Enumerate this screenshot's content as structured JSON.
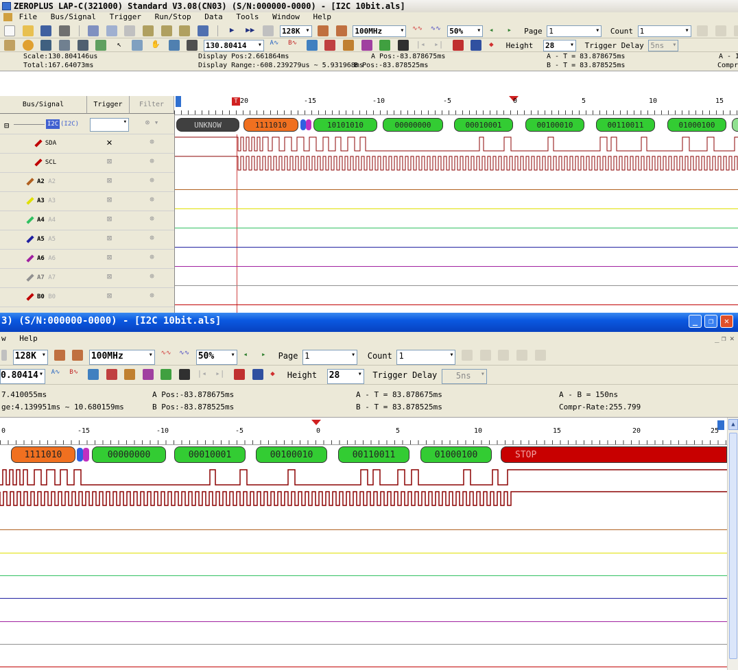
{
  "window1": {
    "title": "ZEROPLUS LAP-C(321000) Standard V3.08(CN03) (S/N:000000-0000) - [I2C 10bit.als]",
    "menu": [
      "File",
      "Bus/Signal",
      "Trigger",
      "Run/Stop",
      "Data",
      "Tools",
      "Window",
      "Help"
    ],
    "toolbar": {
      "memory": "128K",
      "clock": "100MHz",
      "ratio": "50%",
      "page_label": "Page",
      "page_value": "1",
      "count_label": "Count",
      "count_value": "1",
      "scale_combo": "130.80414",
      "height_label": "Height",
      "height_value": "28",
      "trigger_delay_label": "Trigger Delay",
      "trigger_delay_value": "5ns"
    },
    "info": {
      "scale": "Scale:130.804146us",
      "total": "Total:167.64073ms",
      "display_pos": "Display Pos:2.661864ms",
      "display_range": "Display Range:-608.239279us ~ 5.931968ms",
      "a_pos": "A Pos:-83.878675ms",
      "b_pos": "B Pos:-83.878525ms",
      "a_t": "A - T = 83.878675ms",
      "b_t": "B - T = 83.878525ms",
      "a_clip": "A - I",
      "compr_clip": "Compr"
    },
    "headers": {
      "bus": "Bus/Signal",
      "trigger": "Trigger",
      "filter": "Filter"
    },
    "signals": [
      {
        "name": "I2C",
        "alias": "(I2C)",
        "color": "#4060d0"
      },
      {
        "name": "SDA",
        "alias": "",
        "color": "#c00000"
      },
      {
        "name": "SCL",
        "alias": "",
        "color": "#c00000"
      },
      {
        "name": "A2",
        "alias": "A2",
        "color": "#b06020"
      },
      {
        "name": "A3",
        "alias": "A3",
        "color": "#e0e000"
      },
      {
        "name": "A4",
        "alias": "A4",
        "color": "#30c060"
      },
      {
        "name": "A5",
        "alias": "A5",
        "color": "#2020a0"
      },
      {
        "name": "A6",
        "alias": "A6",
        "color": "#a020a0"
      },
      {
        "name": "A7",
        "alias": "A7",
        "color": "#909090"
      },
      {
        "name": "B0",
        "alias": "B0",
        "color": "#c00000"
      }
    ],
    "ruler": [
      "20",
      "-15",
      "-10",
      "-5",
      "0",
      "5",
      "10",
      "15"
    ],
    "marker_label": "T",
    "bus_segments": [
      "UNKNOW",
      "1111010",
      "10101010",
      "00000000",
      "00010001",
      "00100010",
      "00110011",
      "01000100"
    ]
  },
  "window2": {
    "title": "3) (S/N:000000-0000) - [I2C 10bit.als]",
    "menu": [
      "w",
      "Help"
    ],
    "toolbar": {
      "memory": "128K",
      "clock": "100MHz",
      "ratio": "50%",
      "page_label": "Page",
      "page_value": "1",
      "count_label": "Count",
      "count_value": "1",
      "scale_combo": "0.80414",
      "height_label": "Height",
      "height_value": "28",
      "trigger_delay_label": "Trigger Delay",
      "trigger_delay_value": "5ns"
    },
    "info": {
      "total": "7.410055ms",
      "range": "ge:4.139951ms ~ 10.680159ms",
      "a_pos": "A Pos:-83.878675ms",
      "b_pos": "B Pos:-83.878525ms",
      "a_t": "A - T = 83.878675ms",
      "b_t": "B - T = 83.878525ms",
      "a_b": "A - B = 150ns",
      "compr": "Compr-Rate:255.799"
    },
    "ruler": [
      "0",
      "-15",
      "-10",
      "-5",
      "0",
      "5",
      "10",
      "15",
      "20",
      "25"
    ],
    "bus_segments": [
      "1111010",
      "00000000",
      "00010001",
      "00100010",
      "00110011",
      "01000100",
      "STOP"
    ]
  },
  "colors": {
    "title_blue": "#0a58e0",
    "bus_green": "#33cc33",
    "bus_orange": "#f07020",
    "stop_red": "#c80000",
    "wave": "#8b0000"
  }
}
